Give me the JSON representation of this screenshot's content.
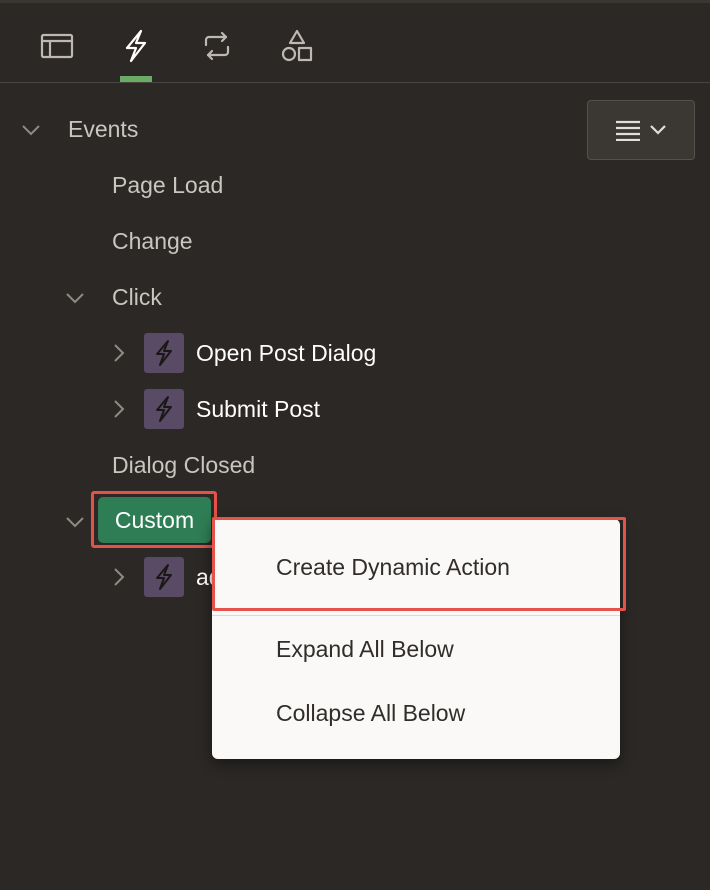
{
  "tabs": [
    {
      "name": "layout",
      "icon": "layout-icon"
    },
    {
      "name": "dynamic-actions",
      "icon": "lightning-icon",
      "active": true
    },
    {
      "name": "processing",
      "icon": "refresh-icon"
    },
    {
      "name": "shared-components",
      "icon": "shapes-icon"
    }
  ],
  "toolbar": {
    "menu_icon": "hamburger-icon",
    "dropdown_icon": "chevron-down-icon"
  },
  "tree": {
    "events_label": "Events",
    "page_load": "Page Load",
    "change": "Change",
    "click": "Click",
    "open_post_dialog": "Open Post Dialog",
    "submit_post": "Submit Post",
    "dialog_closed": "Dialog Closed",
    "custom": "Custom",
    "custom_child_partial": "ad"
  },
  "context_menu": {
    "create_dynamic_action": "Create Dynamic Action",
    "expand_all_below": "Expand All Below",
    "collapse_all_below": "Collapse All Below"
  },
  "colors": {
    "background": "#2b2825",
    "accent_green": "#6aaa64",
    "selected_green": "#2f7d55",
    "action_icon_bg": "#594a66",
    "highlight_red": "#e5524a"
  }
}
